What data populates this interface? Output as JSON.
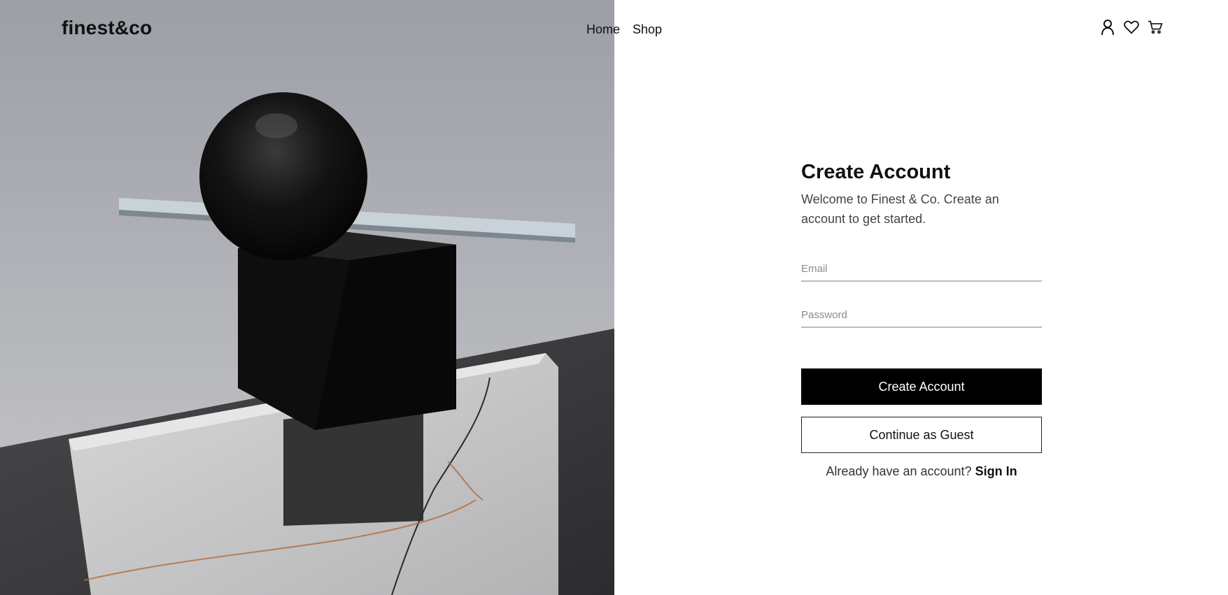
{
  "header": {
    "logo": "finest&co",
    "nav": [
      {
        "label": "Home"
      },
      {
        "label": "Shop"
      }
    ],
    "icons": [
      "user-icon",
      "heart-icon",
      "cart-icon"
    ]
  },
  "hero": {
    "image": "black sphere on black cube with white rod, resting on marble slab"
  },
  "form": {
    "title": "Create Account",
    "subtitle": "Welcome to Finest & Co. Create an account to get started.",
    "email_placeholder": "Email",
    "password_placeholder": "Password",
    "create_button": "Create Account",
    "guest_button": "Continue as Guest",
    "signin_prompt": "Already have an account?",
    "signin_link": "Sign In"
  },
  "colors": {
    "primary_button": "#000000",
    "background": "#ffffff",
    "text": "#111111"
  }
}
